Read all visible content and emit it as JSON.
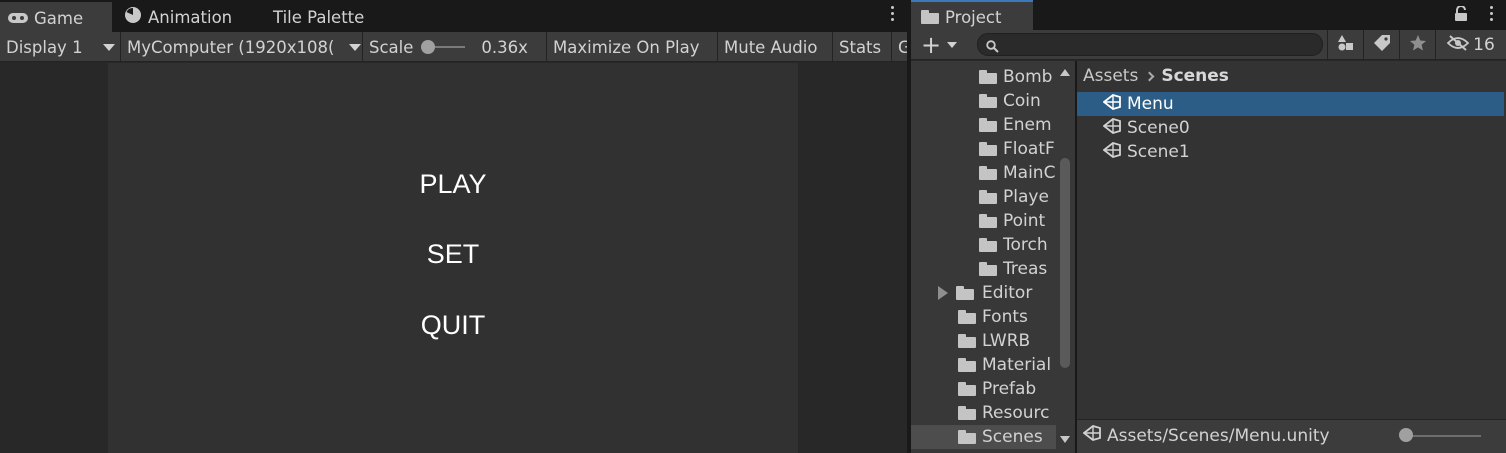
{
  "game_panel": {
    "tabs": [
      {
        "label": "Game",
        "icon": "gamepad-icon",
        "active": true
      },
      {
        "label": "Animation",
        "icon": "clock-icon",
        "active": false
      },
      {
        "label": "Tile Palette",
        "icon": "",
        "active": false
      }
    ],
    "toolbar": {
      "display": "Display 1",
      "resolution": "MyComputer (1920x108(",
      "scale_label": "Scale",
      "scale_value": "0.36x",
      "maximize": "Maximize On Play",
      "mute": "Mute Audio",
      "stats": "Stats",
      "gizmos": "G"
    },
    "menu": {
      "play": "PLAY",
      "set": "SET",
      "quit": "QUIT"
    }
  },
  "project_panel": {
    "tab": {
      "label": "Project",
      "icon": "folder-icon"
    },
    "toolbar": {
      "add_symbol": "+",
      "search_placeholder": "",
      "hidden_count": "16"
    },
    "tree": [
      {
        "label": "Bomb",
        "depth": 2,
        "expandable": false,
        "selected": false
      },
      {
        "label": "Coin",
        "depth": 2,
        "expandable": false,
        "selected": false
      },
      {
        "label": "Enem",
        "depth": 2,
        "expandable": false,
        "selected": false
      },
      {
        "label": "FloatF",
        "depth": 2,
        "expandable": false,
        "selected": false
      },
      {
        "label": "MainC",
        "depth": 2,
        "expandable": false,
        "selected": false
      },
      {
        "label": "Playe",
        "depth": 2,
        "expandable": false,
        "selected": false
      },
      {
        "label": "Point",
        "depth": 2,
        "expandable": false,
        "selected": false
      },
      {
        "label": "Torch",
        "depth": 2,
        "expandable": false,
        "selected": false
      },
      {
        "label": "Treas",
        "depth": 2,
        "expandable": false,
        "selected": false
      },
      {
        "label": "Editor",
        "depth": 1,
        "expandable": true,
        "selected": false
      },
      {
        "label": "Fonts",
        "depth": 1,
        "expandable": false,
        "selected": false
      },
      {
        "label": "LWRB",
        "depth": 1,
        "expandable": false,
        "selected": false
      },
      {
        "label": "Material",
        "depth": 1,
        "expandable": false,
        "selected": false
      },
      {
        "label": "Prefab",
        "depth": 1,
        "expandable": false,
        "selected": false
      },
      {
        "label": "Resourc",
        "depth": 1,
        "expandable": false,
        "selected": false
      },
      {
        "label": "Scenes",
        "depth": 1,
        "expandable": false,
        "selected": true
      }
    ],
    "breadcrumb": [
      "Assets",
      "Scenes"
    ],
    "assets": [
      {
        "label": "Menu",
        "selected": true
      },
      {
        "label": "Scene0",
        "selected": false
      },
      {
        "label": "Scene1",
        "selected": false
      }
    ],
    "status_path": "Assets/Scenes/Menu.unity"
  },
  "colors": {
    "selection_blue": "#2c5d87",
    "active_tab_accent": "#3a79bb"
  }
}
